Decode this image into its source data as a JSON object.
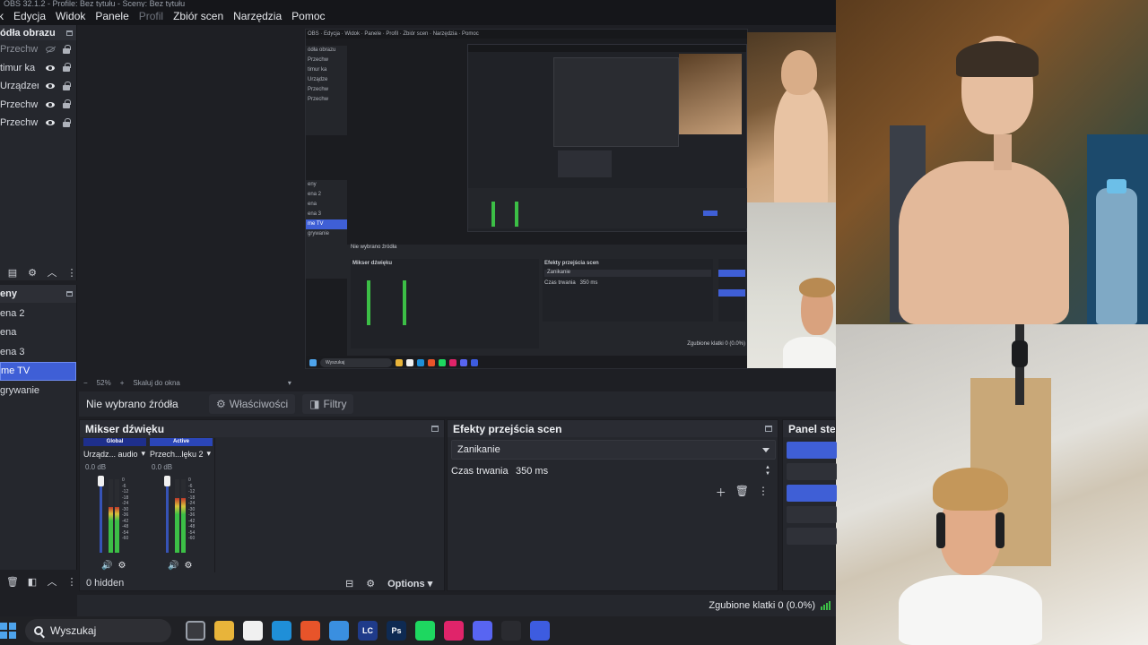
{
  "window": {
    "title": "OBS 32.1.2 - Profile: Bez tytułu - Sceny: Bez tytułu"
  },
  "menu": [
    "k",
    "Edycja",
    "Widok",
    "Panele",
    "Profil",
    "Zbiór scen",
    "Narzędzia",
    "Pomoc"
  ],
  "sources": {
    "header": "ódła obrazu",
    "items": [
      {
        "label": "Przechw",
        "visible": false
      },
      {
        "label": "timur ka",
        "visible": true
      },
      {
        "label": "Urządzer",
        "visible": true
      },
      {
        "label": "Przechw",
        "visible": true
      },
      {
        "label": "Przechw",
        "visible": true
      }
    ]
  },
  "scenes": {
    "header": "eny",
    "items": [
      {
        "label": "ena 2",
        "active": false
      },
      {
        "label": "ena",
        "active": false
      },
      {
        "label": "ena 3",
        "active": false
      },
      {
        "label": "me TV",
        "active": true
      },
      {
        "label": "grywanie",
        "active": false
      }
    ]
  },
  "zoom": {
    "value": "52%",
    "fit": "Skaluj do okna"
  },
  "source_bar": {
    "no_source": "Nie wybrano źródła",
    "properties": "Właściwości",
    "filters": "Filtry"
  },
  "mixer": {
    "title": "Mikser dźwięku",
    "channels": [
      {
        "tag": "Global",
        "name": "Urządz... audio",
        "db": "0.0 dB",
        "level": 0.62,
        "tag_color": "#1e2f8c"
      },
      {
        "tag": "Active",
        "name": "Przech...lęku 2",
        "db": "0.0 dB",
        "level": 0.74,
        "tag_color": "#2b46b8"
      }
    ],
    "scale": [
      "0",
      "-6",
      "-12",
      "-18",
      "-24",
      "-30",
      "-36",
      "-42",
      "-48",
      "-54",
      "-60"
    ]
  },
  "transitions": {
    "title": "Efekty przejścia scen",
    "selected": "Zanikanie",
    "duration_label": "Czas trwania",
    "duration_value": "350 ms"
  },
  "controls": {
    "title": "Panel steru"
  },
  "hidden_label": "0 hidden",
  "options_label": "Options",
  "status": {
    "dropped": "Zgubione klatki 0 (0.0%)"
  },
  "taskbar": {
    "search": "Wyszukaj",
    "apps": [
      {
        "icon": "task-view-icon",
        "text": "",
        "color": "#3a3b40"
      },
      {
        "icon": "file-explorer-icon",
        "text": "",
        "color": "#e8b43a"
      },
      {
        "icon": "store-icon",
        "text": "",
        "color": "#f0f0f0"
      },
      {
        "icon": "edge-icon",
        "text": "",
        "color": "#1f8fd8"
      },
      {
        "icon": "firefox-icon",
        "text": "",
        "color": "#e8542a"
      },
      {
        "icon": "app-icon",
        "text": "",
        "color": "#3a8fe0"
      },
      {
        "icon": "lc-icon",
        "text": "LC",
        "color": "#1f3b8a"
      },
      {
        "icon": "photoshop-icon",
        "text": "Ps",
        "color": "#0e2a52"
      },
      {
        "icon": "spotify-icon",
        "text": "",
        "color": "#1ed760"
      },
      {
        "icon": "app-pink-icon",
        "text": "",
        "color": "#e0246a"
      },
      {
        "icon": "discord-icon",
        "text": "",
        "color": "#5865f2"
      },
      {
        "icon": "obs-icon",
        "text": "",
        "color": "#2a2b30"
      },
      {
        "icon": "app-blue-icon",
        "text": "",
        "color": "#3d5ce0"
      }
    ]
  }
}
